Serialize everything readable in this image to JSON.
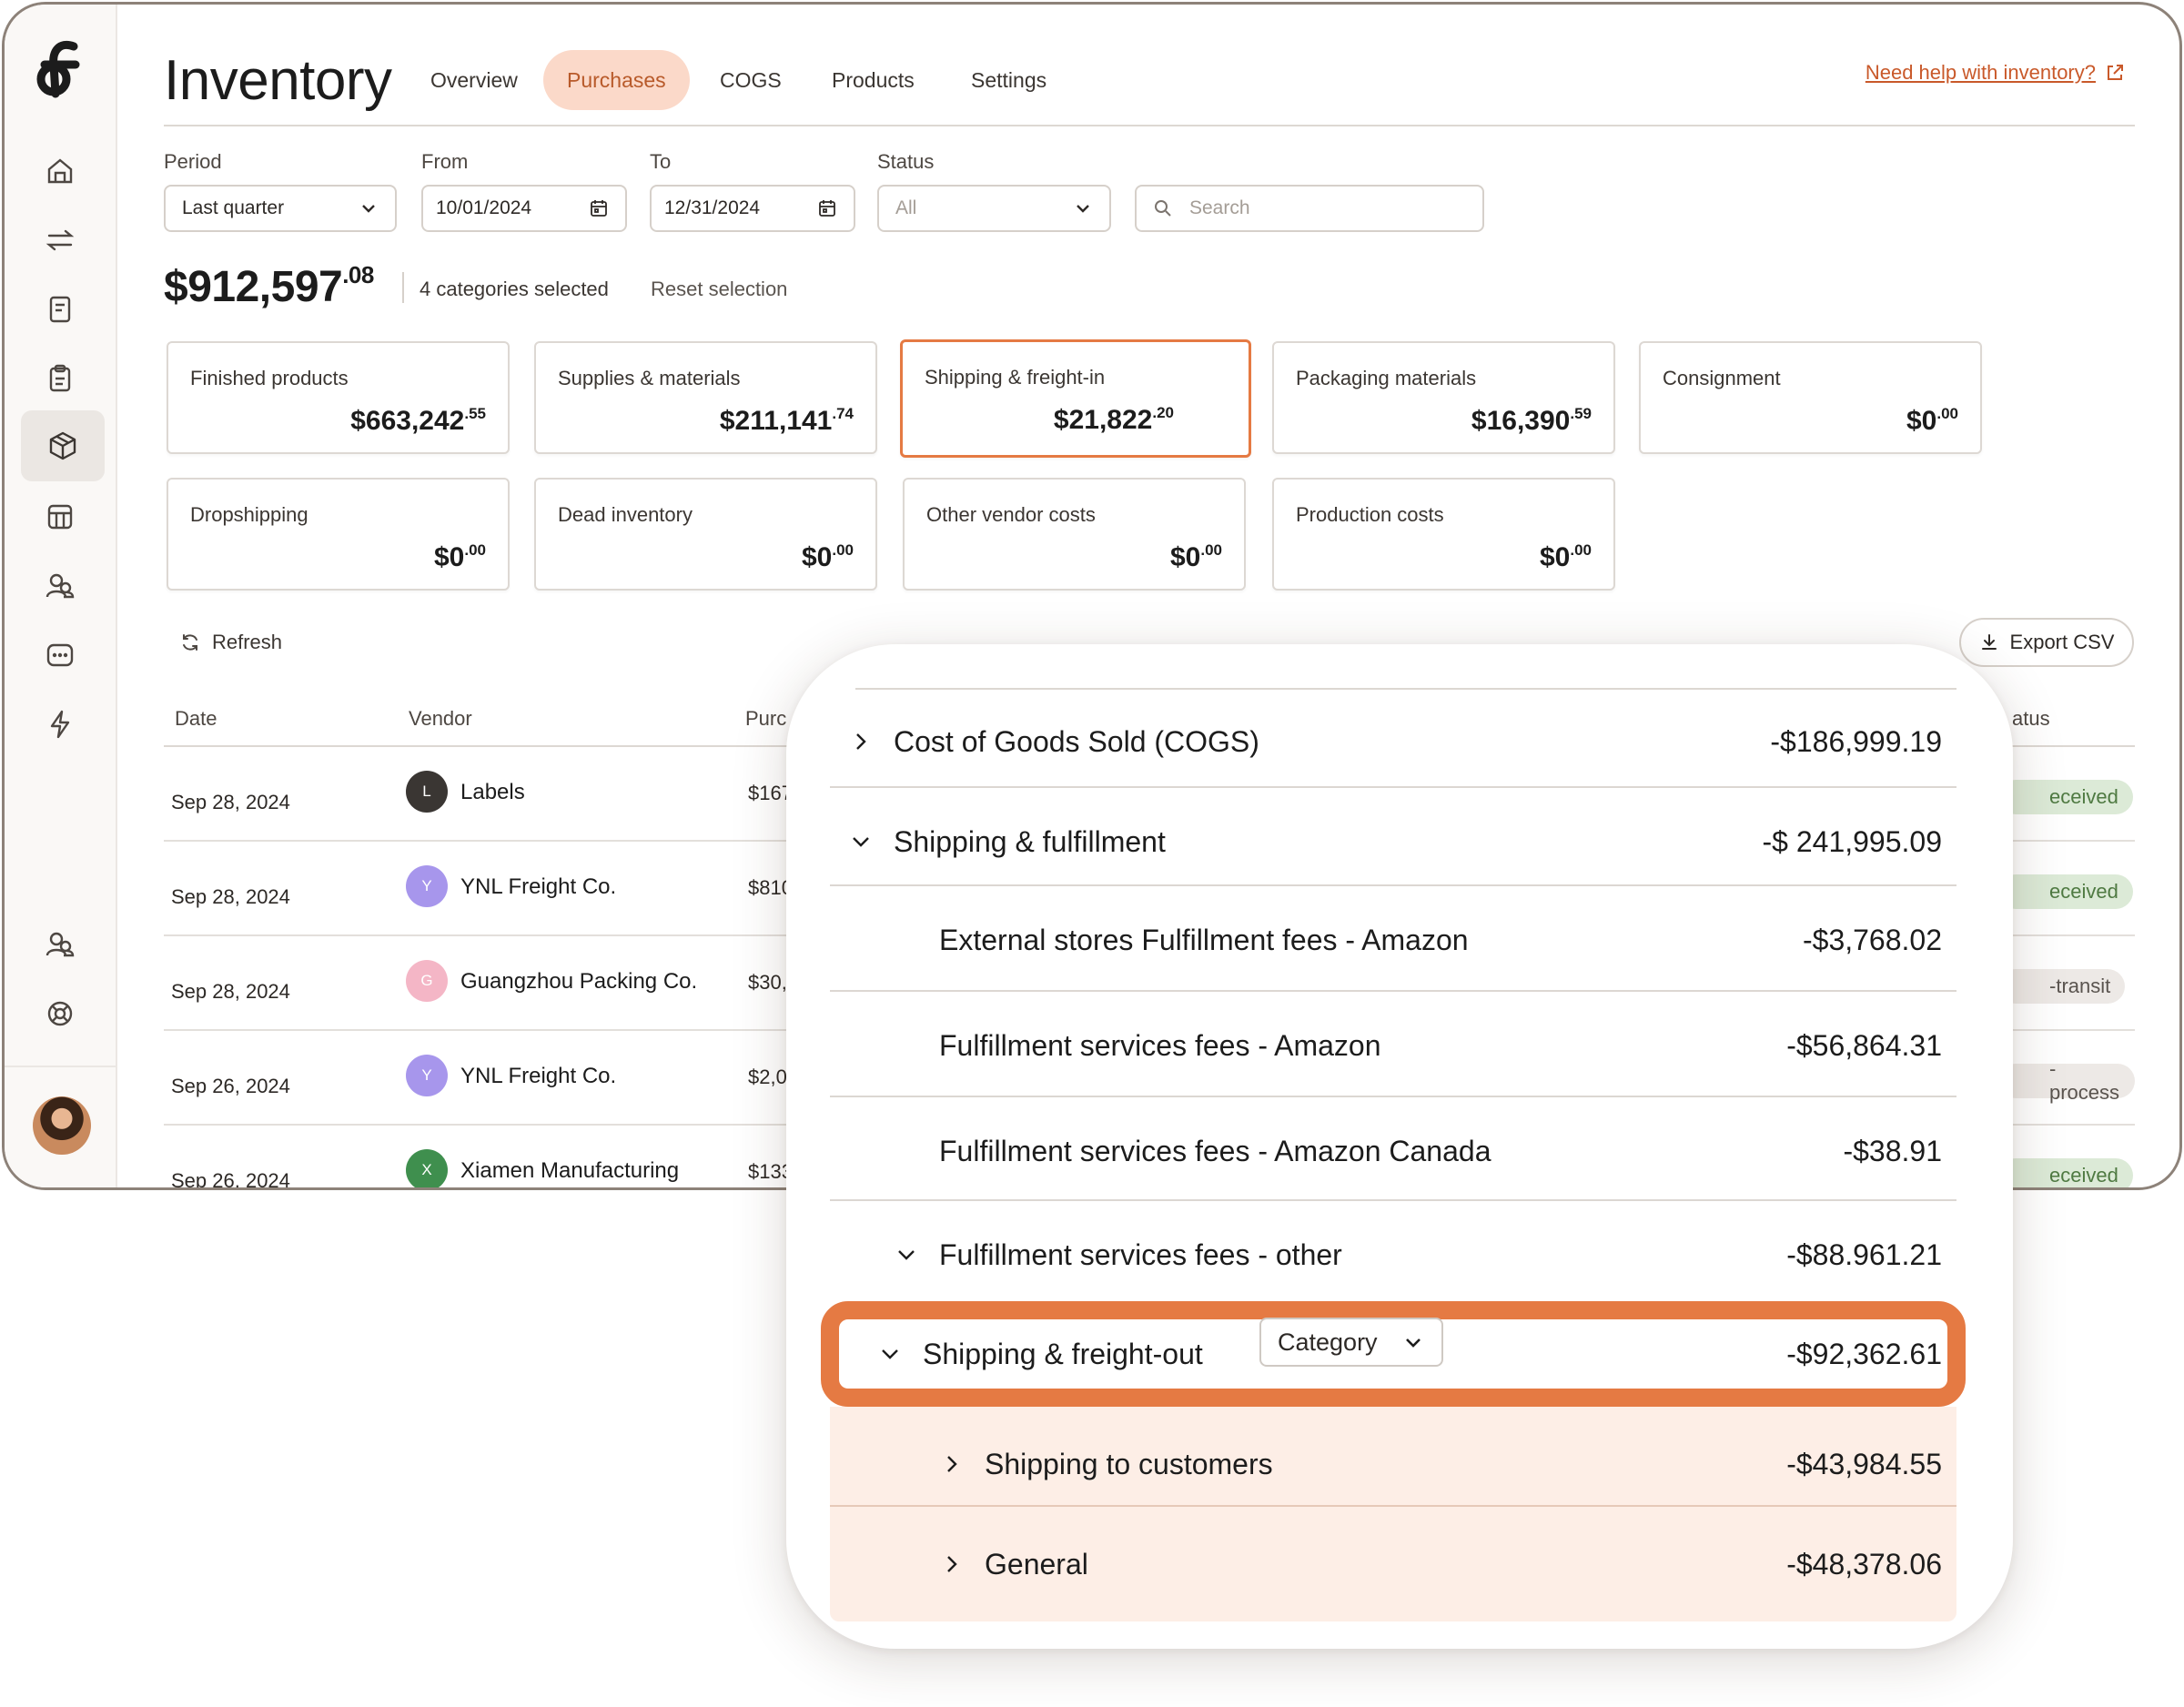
{
  "header": {
    "title": "Inventory",
    "tabs": [
      "Overview",
      "Purchases",
      "COGS",
      "Products",
      "Settings"
    ],
    "active_tab": "Purchases",
    "help_link": "Need help with inventory?"
  },
  "sidebar": {
    "icons": [
      "home-icon",
      "transfer-icon",
      "invoice-icon",
      "clipboard-icon",
      "package-icon",
      "store-icon",
      "users-icon",
      "chat-icon",
      "bolt-icon",
      "team-icon",
      "help-icon"
    ],
    "active": "package-icon"
  },
  "filters": {
    "period_label": "Period",
    "period_value": "Last quarter",
    "from_label": "From",
    "from_value": "10/01/2024",
    "to_label": "To",
    "to_value": "12/31/2024",
    "status_label": "Status",
    "status_value": "All",
    "search_placeholder": "Search"
  },
  "summary": {
    "total_main": "$912,597",
    "total_cents": ".08",
    "selected_text": "4 categories selected",
    "reset_label": "Reset selection"
  },
  "categories": [
    {
      "name": "Finished products",
      "main": "$663,242",
      "cents": ".55"
    },
    {
      "name": "Supplies & materials",
      "main": "$211,141",
      "cents": ".74"
    },
    {
      "name": "Shipping & freight-in",
      "main": "$21,822",
      "cents": ".20"
    },
    {
      "name": "Packaging materials",
      "main": "$16,390",
      "cents": ".59"
    },
    {
      "name": "Consignment",
      "main": "$0",
      "cents": ".00"
    },
    {
      "name": "Dropshipping",
      "main": "$0",
      "cents": ".00"
    },
    {
      "name": "Dead inventory",
      "main": "$0",
      "cents": ".00"
    },
    {
      "name": "Other vendor costs",
      "main": "$0",
      "cents": ".00"
    },
    {
      "name": "Production costs",
      "main": "$0",
      "cents": ".00"
    }
  ],
  "table": {
    "refresh_label": "Refresh",
    "export_label": "Export CSV",
    "columns": {
      "date": "Date",
      "vendor": "Vendor",
      "purchase": "Purc",
      "status": "atus"
    },
    "rows": [
      {
        "date": "Sep 28, 2024",
        "initial": "L",
        "vendor": "Labels",
        "amount": "$167",
        "status": "eceived",
        "color": "#3a3633"
      },
      {
        "date": "Sep 28, 2024",
        "initial": "Y",
        "vendor": "YNL Freight Co.",
        "amount": "$810",
        "status": "eceived",
        "color": "#a796ec"
      },
      {
        "date": "Sep 28, 2024",
        "initial": "G",
        "vendor": "Guangzhou Packing Co.",
        "amount": "$30,",
        "status": "-transit",
        "color": "#f4b6c6"
      },
      {
        "date": "Sep 26, 2024",
        "initial": "Y",
        "vendor": "YNL Freight Co.",
        "amount": "$2,0",
        "status": "-process",
        "color": "#a796ec"
      },
      {
        "date": "Sep 26, 2024",
        "initial": "X",
        "vendor": "Xiamen Manufacturing",
        "amount": "$133",
        "status": "eceived",
        "color": "#3f8f4e"
      }
    ]
  },
  "breakdown": {
    "lines": [
      {
        "label": "Cost of Goods Sold (COGS)",
        "value": "-$186,999.19"
      },
      {
        "label": "Shipping & fulfillment",
        "value": "-$ 241,995.09"
      },
      {
        "label": "External stores Fulfillment fees - Amazon",
        "value": "-$3,768.02"
      },
      {
        "label": "Fulfillment services fees - Amazon",
        "value": "-$56,864.31"
      },
      {
        "label": "Fulfillment services fees - Amazon Canada",
        "value": "-$38.91"
      },
      {
        "label": "Fulfillment services fees - other",
        "value": "-$88.961.21"
      },
      {
        "label": "Shipping & freight-out",
        "value": "-$92,362.61"
      },
      {
        "label": "Shipping to customers",
        "value": "-$43,984.55"
      },
      {
        "label": "General",
        "value": "-$48,378.06"
      }
    ],
    "category_select": "Category"
  },
  "colors": {
    "accent": "#e57a43",
    "accent_soft": "#fbd9c9",
    "highlight_fill": "#fdeee6"
  }
}
